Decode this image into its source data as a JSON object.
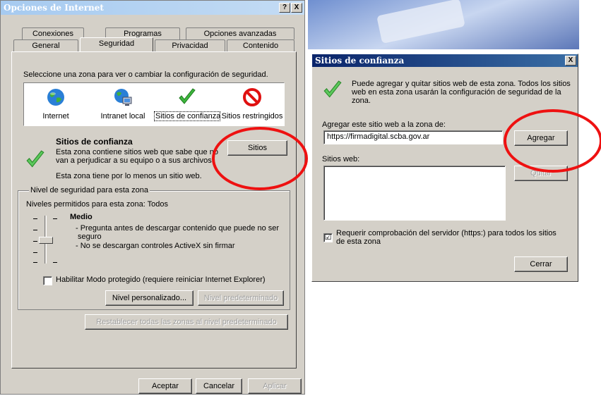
{
  "main": {
    "title": "Opciones de Internet",
    "help_btn": "?",
    "close_btn": "X",
    "tabs_back": [
      "Conexiones",
      "Programas",
      "Opciones avanzadas"
    ],
    "tabs_front": [
      "General",
      "Seguridad",
      "Privacidad",
      "Contenido"
    ],
    "select_zone_text": "Seleccione una zona para ver o cambiar la configuración de seguridad.",
    "zones": [
      "Internet",
      "Intranet local",
      "Sitios de confianza",
      "Sitios restringidos"
    ],
    "zone_title": "Sitios de confianza",
    "zone_desc_1": "Esta zona contiene sitios web que sabe que no",
    "zone_desc_2": "van a perjudicar a su equipo o a sus archivos.",
    "zone_desc_3": "Esta zona tiene por lo menos un sitio web.",
    "sites_btn": "Sitios",
    "security_group": "Nivel de seguridad para esta zona",
    "allowed_levels": "Niveles permitidos para esta zona: Todos",
    "level_name": "Medio",
    "level_bullet_1a": "- Pregunta antes de descargar contenido que puede no ser",
    "level_bullet_1b": "seguro",
    "level_bullet_2": "- No se descargan controles ActiveX sin firmar",
    "protected_mode": "Habilitar Modo protegido (requiere reiniciar Internet Explorer)",
    "custom_level_btn": "Nivel personalizado...",
    "default_level_btn": "Nivel predeterminado",
    "reset_all_btn": "Restablecer todas las zonas al nivel predeterminado",
    "ok_btn": "Aceptar",
    "cancel_btn": "Cancelar",
    "apply_btn": "Aplicar"
  },
  "dialog": {
    "title": "Sitios de confianza",
    "close_btn": "X",
    "info_1": "Puede agregar y quitar sitios web de esta zona. Todos los sitios",
    "info_2": "web en esta zona usarán la configuración de seguridad de la",
    "info_3": "zona.",
    "add_label": "Agregar este sitio web a la zona de:",
    "url_value": "https://firmadigital.scba.gov.ar",
    "add_btn": "Agregar",
    "websites_label": "Sitios web:",
    "remove_btn": "Quitar",
    "require_https_1": "Requerir comprobación del servidor (https:) para todos los sitios",
    "require_https_2": "de esta zona",
    "require_https_checked": "☑",
    "close_dialog_btn": "Cerrar"
  },
  "colors": {
    "accent_red": "#ee1111",
    "dialog_bg": "#d4d0c8",
    "title_active": "#0a246a"
  }
}
